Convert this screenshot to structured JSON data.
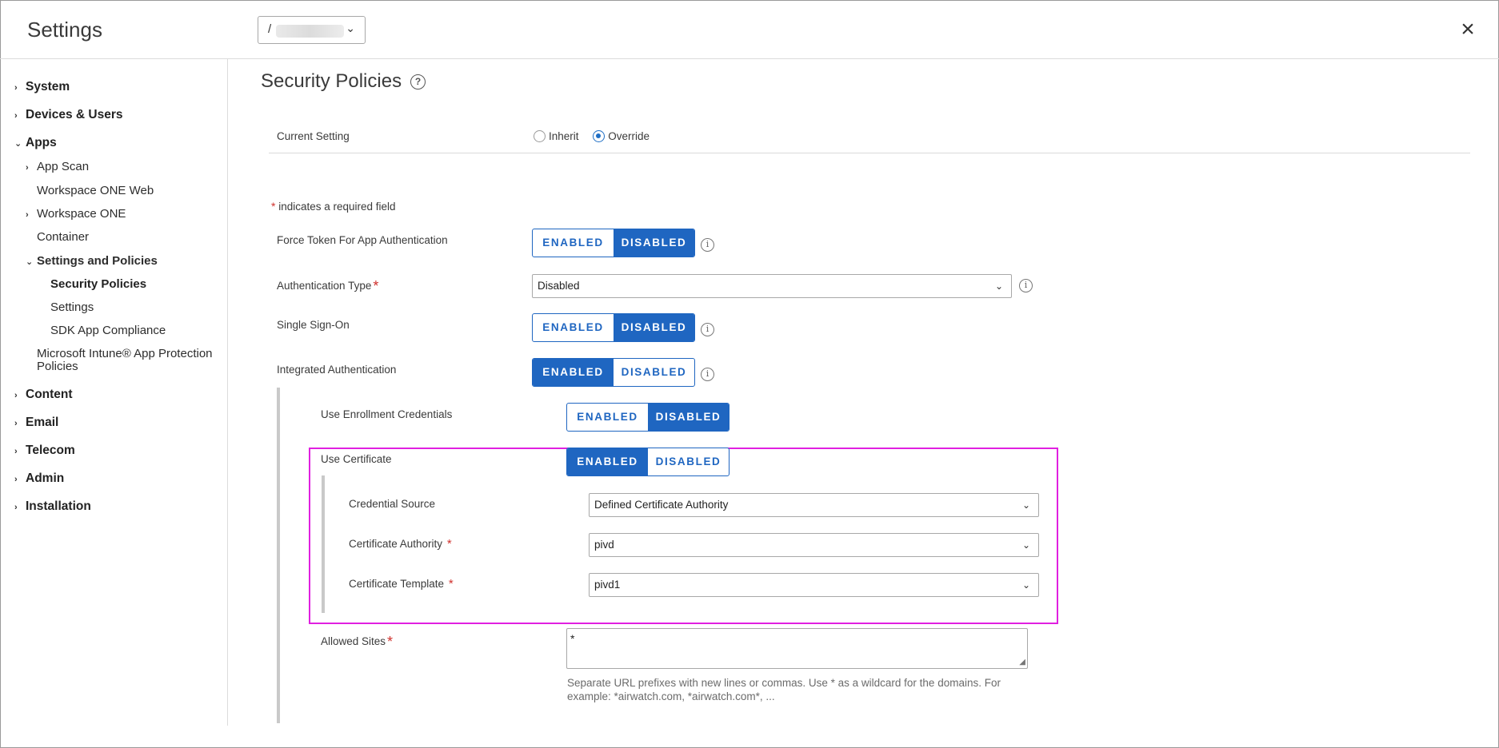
{
  "header": {
    "title": "Settings",
    "org_prefix": "/",
    "close_icon": "close-icon"
  },
  "sidebar": {
    "items": [
      {
        "label": "System",
        "level": 0,
        "expanded": false
      },
      {
        "label": "Devices & Users",
        "level": 0,
        "expanded": false
      },
      {
        "label": "Apps",
        "level": 0,
        "expanded": true
      },
      {
        "label": "App Scan",
        "level": 1,
        "expanded": false
      },
      {
        "label": "Workspace ONE Web",
        "level": 1
      },
      {
        "label": "Workspace ONE",
        "level": 1,
        "expanded": false
      },
      {
        "label": "Container",
        "level": 1
      },
      {
        "label": "Settings and Policies",
        "level": 1,
        "expanded": true
      },
      {
        "label": "Security Policies",
        "level": 2,
        "active": true
      },
      {
        "label": "Settings",
        "level": 2
      },
      {
        "label": "SDK App Compliance",
        "level": 2
      },
      {
        "label": "Microsoft Intune® App Protection",
        "level": 1
      },
      {
        "label": "Policies",
        "level": 1
      },
      {
        "label": "Content",
        "level": 0,
        "expanded": false
      },
      {
        "label": "Email",
        "level": 0,
        "expanded": false
      },
      {
        "label": "Telecom",
        "level": 0,
        "expanded": false
      },
      {
        "label": "Admin",
        "level": 0,
        "expanded": false
      },
      {
        "label": "Installation",
        "level": 0,
        "expanded": false
      }
    ]
  },
  "main": {
    "title": "Security Policies",
    "help_icon": "?",
    "current_setting": {
      "label": "Current Setting",
      "options": [
        "Inherit",
        "Override"
      ],
      "selected": "Override"
    },
    "required_note": {
      "star": "*",
      "text": "indicates a required field"
    },
    "toggle_enabled": "ENABLED",
    "toggle_disabled": "DISABLED",
    "info_glyph": "i",
    "fields": {
      "force_token": {
        "label": "Force Token For App Authentication",
        "value": "DISABLED"
      },
      "auth_type": {
        "label": "Authentication Type",
        "required_star": "*",
        "value": "Disabled"
      },
      "sso": {
        "label": "Single Sign-On",
        "value": "DISABLED"
      },
      "integrated_auth": {
        "label": "Integrated Authentication",
        "value": "ENABLED"
      },
      "enrollment_creds": {
        "label": "Use Enrollment Credentials",
        "value": "DISABLED"
      },
      "use_certificate": {
        "label": "Use Certificate",
        "value": "ENABLED"
      },
      "credential_source": {
        "label": "Credential Source",
        "value": "Defined Certificate Authority"
      },
      "cert_authority": {
        "label": "Certificate Authority",
        "required_star": "*",
        "value": "pivd"
      },
      "cert_template": {
        "label": "Certificate Template",
        "required_star": "*",
        "value": "pivd1"
      },
      "allowed_sites": {
        "label": "Allowed Sites",
        "required_star": "*",
        "value": "*",
        "hint": "Separate URL prefixes with new lines or commas. Use * as a wildcard for the domains. For example: *airwatch.com, *airwatch.com*, ..."
      }
    }
  },
  "colors": {
    "accent": "#1f66c1",
    "required": "#d0312d",
    "highlight_border": "#e020e0"
  }
}
